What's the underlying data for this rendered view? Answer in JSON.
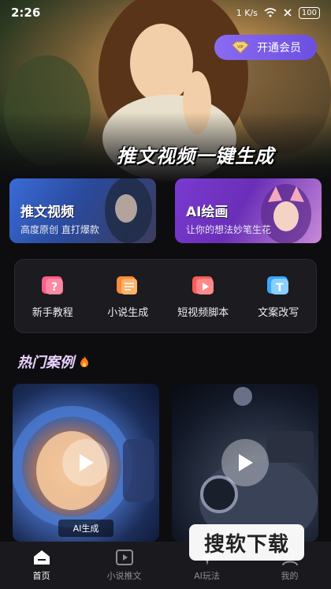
{
  "status_bar": {
    "time": "2:26",
    "speed": "1 K/s",
    "battery": "100"
  },
  "header": {
    "vip_label": "开通会员",
    "hero_title": "推文视频一键生成"
  },
  "feature_cards": [
    {
      "title": "推文视频",
      "subtitle": "高度原创 直打爆款"
    },
    {
      "title": "AI绘画",
      "subtitle": "让你的想法妙笔生花"
    }
  ],
  "tools": [
    {
      "label": "新手教程",
      "icon": "question-book-icon"
    },
    {
      "label": "小说生成",
      "icon": "document-icon"
    },
    {
      "label": "短视频脚本",
      "icon": "video-play-icon"
    },
    {
      "label": "文案改写",
      "icon": "text-t-icon"
    }
  ],
  "section": {
    "title": "热门案例"
  },
  "cases": [
    {
      "tag": "AI生成"
    },
    {
      "tag": ""
    }
  ],
  "nav": {
    "items": [
      {
        "label": "首页",
        "icon": "home-icon",
        "active": true
      },
      {
        "label": "小说推文",
        "icon": "video-icon",
        "active": false
      },
      {
        "label": "AI玩法",
        "icon": "sparkle-icon",
        "active": false
      },
      {
        "label": "我的",
        "icon": "profile-icon",
        "active": false
      }
    ]
  },
  "watermark": "搜软下载",
  "colors": {
    "background": "#0d0d10",
    "vip_gradient_start": "#8a6bf0",
    "card1_accent": "#3a6bd8",
    "card2_accent": "#7a3ad0",
    "section_title": "#e9d3ff",
    "nav_background": "#1a1a1e"
  }
}
